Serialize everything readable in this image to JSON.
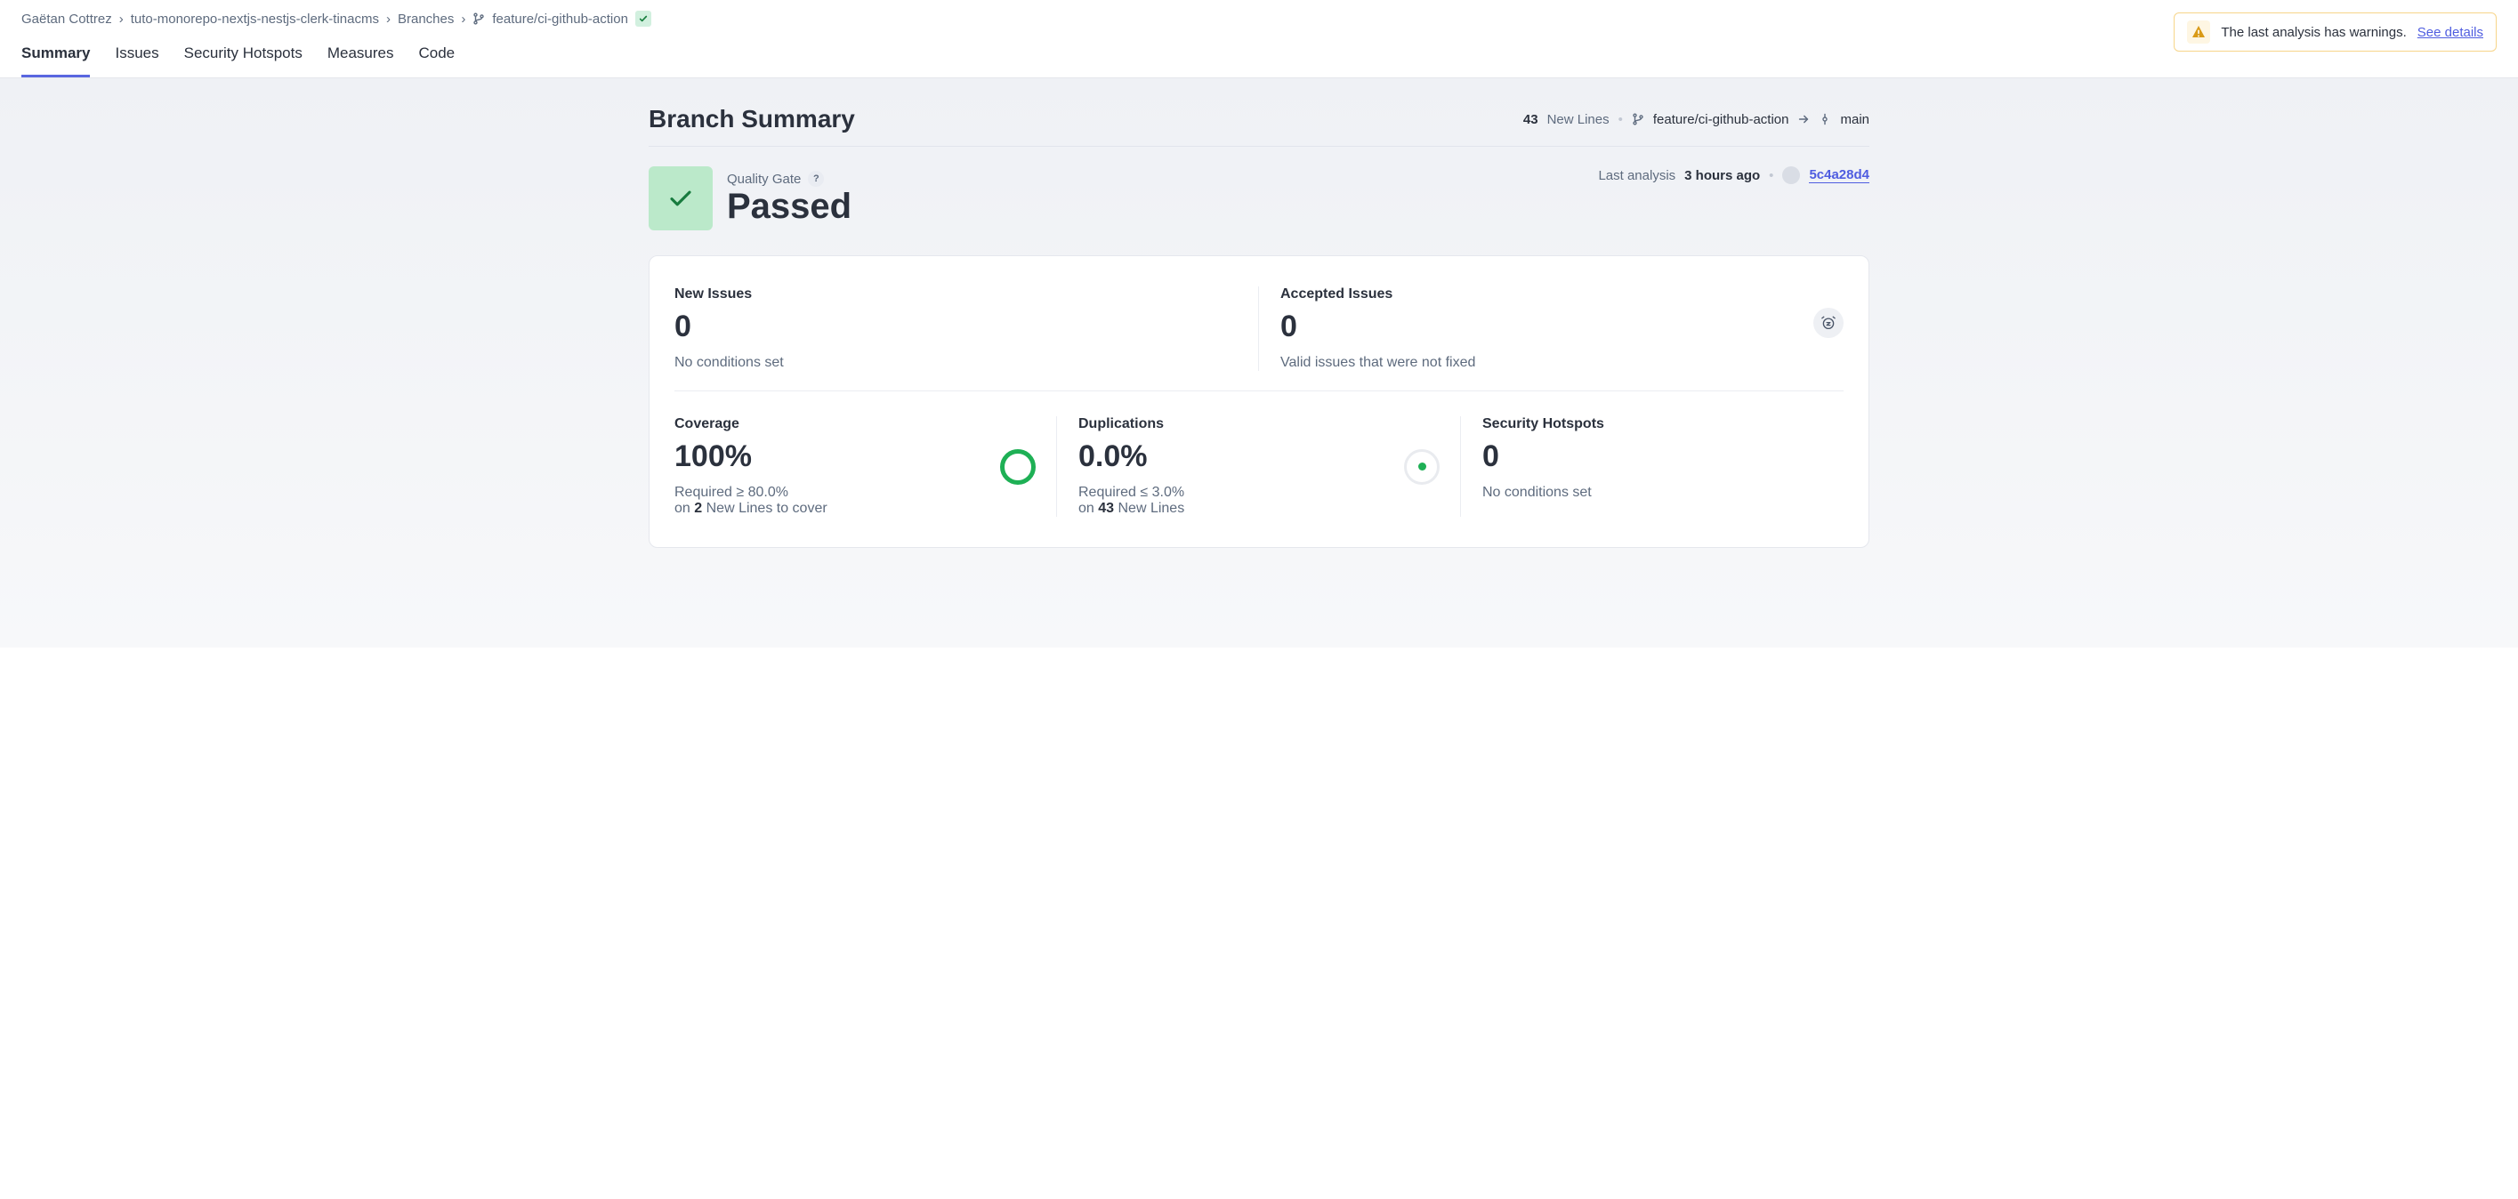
{
  "breadcrumb": {
    "owner": "Gaëtan Cottrez",
    "project": "tuto-monorepo-nextjs-nestjs-clerk-tinacms",
    "branches_label": "Branches",
    "branch": "feature/ci-github-action"
  },
  "warning": {
    "text": "The last analysis has warnings.",
    "link": "See details"
  },
  "tabs": {
    "summary": "Summary",
    "issues": "Issues",
    "security": "Security Hotspots",
    "measures": "Measures",
    "code": "Code"
  },
  "title": "Branch Summary",
  "title_meta": {
    "new_lines_count": "43",
    "new_lines_label": "New Lines",
    "branch": "feature/ci-github-action",
    "target": "main"
  },
  "quality_gate": {
    "label": "Quality Gate",
    "status": "Passed",
    "last_analysis_prefix": "Last analysis",
    "last_analysis_time": "3 hours ago",
    "commit": "5c4a28d4"
  },
  "stats": {
    "new_issues": {
      "label": "New Issues",
      "value": "0",
      "desc": "No conditions set"
    },
    "accepted_issues": {
      "label": "Accepted Issues",
      "value": "0",
      "desc": "Valid issues that were not fixed"
    },
    "coverage": {
      "label": "Coverage",
      "value": "100%",
      "req": "Required ≥ 80.0%",
      "on_prefix": "on",
      "on_count": "2",
      "on_suffix": "New Lines to cover"
    },
    "duplications": {
      "label": "Duplications",
      "value": "0.0%",
      "req": "Required ≤ 3.0%",
      "on_prefix": "on",
      "on_count": "43",
      "on_suffix": "New Lines"
    },
    "security": {
      "label": "Security Hotspots",
      "value": "0",
      "desc": "No conditions set"
    }
  }
}
